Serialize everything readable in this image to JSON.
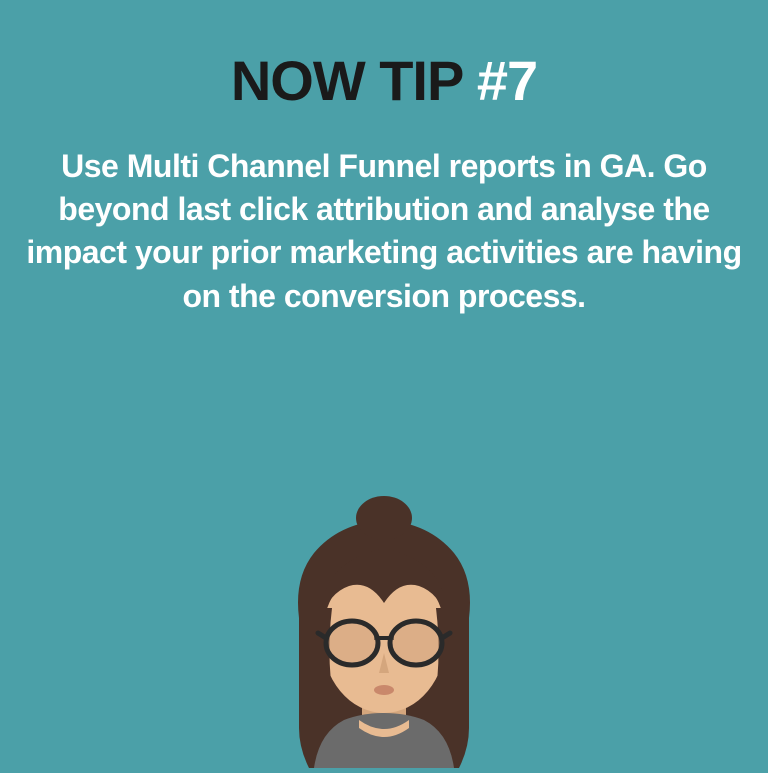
{
  "title": {
    "prefix": "NOW TIP ",
    "number": "#7"
  },
  "body": "Use Multi Channel Funnel reports in GA. Go beyond last click attribution and analyse the impact your prior marketing activities are having on the conversion process.",
  "colors": {
    "background": "#4ba0a8",
    "titleDark": "#1a1a1a",
    "white": "#ffffff"
  },
  "avatar": {
    "description": "woman-with-glasses-illustration"
  }
}
